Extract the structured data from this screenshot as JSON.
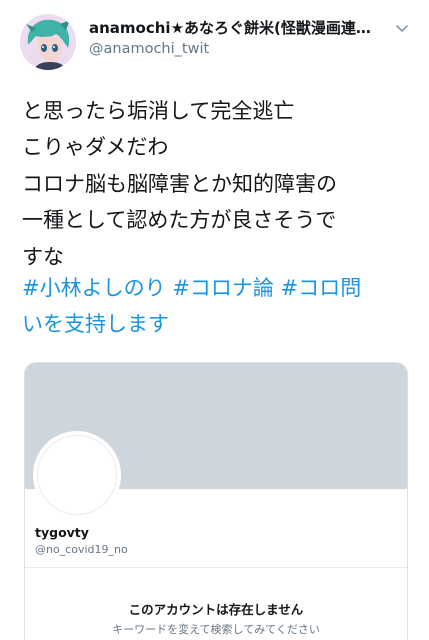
{
  "tweet": {
    "author": {
      "display_name": "anamochi★あなろぐ餅米(怪獣漫画連…",
      "handle": "@anamochi_twit",
      "avatar_icon": "anime-character-avatar-icon"
    },
    "text_lines": [
      "と思ったら垢消して完全逃亡",
      "こりゃダメだわ",
      "コロナ脳も脳障害とか知的障害の",
      "一種として認めた方が良さそうで",
      "すな"
    ],
    "hashtag_lines": [
      [
        "#小林よしのり",
        "#コロナ論",
        "#コロ問"
      ],
      [
        "いを支持します"
      ]
    ],
    "menu_icon": "chevron-down-icon"
  },
  "embedded_card": {
    "name": "tygovty",
    "handle": "@no_covid19_no",
    "status": "このアカウントは存在しません",
    "subtext": "キーワードを変えて検索してみてください"
  },
  "colors": {
    "link": "#1b95e0",
    "text": "#14171a",
    "muted": "#657786",
    "banner": "#cdd6dd",
    "border": "#d9e1e8"
  }
}
